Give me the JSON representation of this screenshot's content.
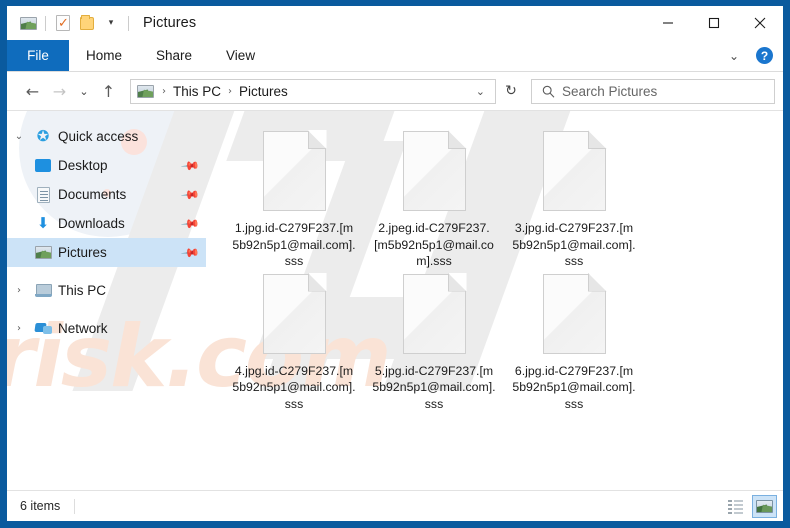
{
  "window": {
    "title": "Pictures",
    "border_color": "#0a5a9e",
    "quick_access_toolbar": [
      {
        "name": "pictures-icon",
        "label": "Pictures"
      },
      {
        "name": "properties-icon",
        "label": "Properties"
      },
      {
        "name": "new-folder-icon",
        "label": "New folder"
      },
      {
        "name": "customize-chevron-icon",
        "label": "▾"
      }
    ],
    "controls": {
      "minimize": "—",
      "maximize": "☐",
      "close": "✕"
    }
  },
  "ribbon": {
    "file_tab": "File",
    "tabs": [
      "Home",
      "Share",
      "View"
    ],
    "collapse_icon": "∨",
    "help_icon": "?",
    "file_tab_color": "#0f6cbd"
  },
  "navigation": {
    "back": "←",
    "forward": "→",
    "recent": "∨",
    "up": "↑",
    "refresh": "↻",
    "dropdown": "∨",
    "breadcrumb_icon": "pictures-icon",
    "breadcrumbs": [
      "This PC",
      "Pictures"
    ],
    "separator": "›"
  },
  "search": {
    "placeholder": "Search Pictures",
    "icon": "search-icon"
  },
  "sidebar": {
    "items": [
      {
        "label": "Quick access",
        "icon": "star-icon",
        "twisty": "⌄",
        "level": 1,
        "selected": false,
        "pinned": false
      },
      {
        "label": "Desktop",
        "icon": "desktop-icon",
        "twisty": "",
        "level": 2,
        "selected": false,
        "pinned": true
      },
      {
        "label": "Documents",
        "icon": "documents-icon",
        "twisty": "",
        "level": 2,
        "selected": false,
        "pinned": true
      },
      {
        "label": "Downloads",
        "icon": "download-icon",
        "twisty": "",
        "level": 2,
        "selected": false,
        "pinned": true
      },
      {
        "label": "Pictures",
        "icon": "pictures-icon",
        "twisty": "",
        "level": 2,
        "selected": true,
        "pinned": true
      },
      {
        "label": "This PC",
        "icon": "computer-icon",
        "twisty": "›",
        "level": 1,
        "selected": false,
        "pinned": false
      },
      {
        "label": "Network",
        "icon": "network-icon",
        "twisty": "›",
        "level": 1,
        "selected": false,
        "pinned": false
      }
    ],
    "pin_glyph": "📌"
  },
  "files": [
    {
      "name": "1.jpg.id-C279F237.[m5b92n5p1@mail.com].sss",
      "icon": "blank-document-icon"
    },
    {
      "name": "2.jpeg.id-C279F237.[m5b92n5p1@mail.com].sss",
      "icon": "blank-document-icon"
    },
    {
      "name": "3.jpg.id-C279F237.[m5b92n5p1@mail.com].sss",
      "icon": "blank-document-icon"
    },
    {
      "name": "4.jpg.id-C279F237.[m5b92n5p1@mail.com].sss",
      "icon": "blank-document-icon"
    },
    {
      "name": "5.jpg.id-C279F237.[m5b92n5p1@mail.com].sss",
      "icon": "blank-document-icon"
    },
    {
      "name": "6.jpg.id-C279F237.[m5b92n5p1@mail.com].sss",
      "icon": "blank-document-icon"
    }
  ],
  "statusbar": {
    "item_count": "6 items",
    "views": [
      {
        "name": "details-view",
        "active": false
      },
      {
        "name": "large-icons-view",
        "active": true
      }
    ]
  },
  "watermark": {
    "text": "risk.com",
    "text_color": "#fae3d6",
    "shape_color": "#ececec"
  }
}
